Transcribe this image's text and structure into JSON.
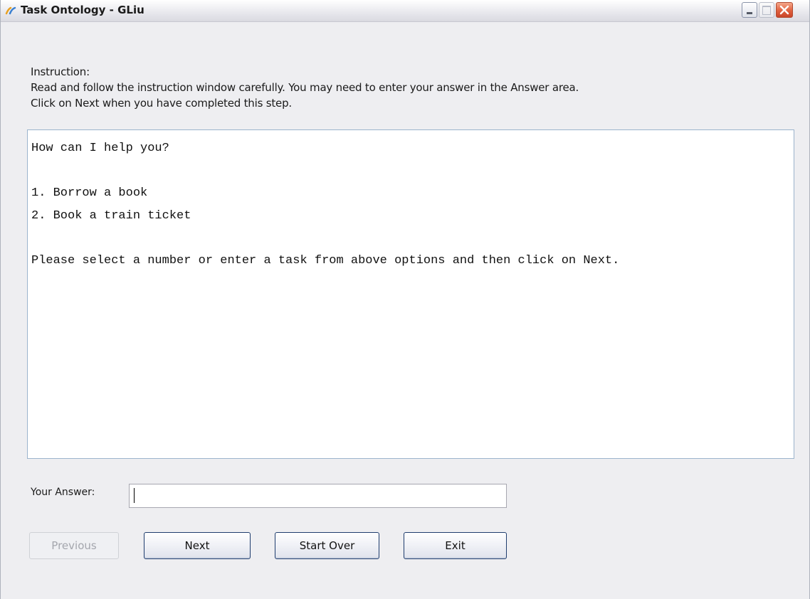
{
  "window": {
    "title": "Task Ontology - GLiu",
    "icon": "app-logo-icon",
    "controls": [
      "minimize-icon",
      "maximize-icon",
      "close-icon"
    ],
    "close_color": "#e0603e"
  },
  "instruction": {
    "line1": "Instruction:",
    "line2": "Read and follow the instruction window carefully. You may need to enter your answer in the Answer area.",
    "line3": "Click on Next when you have completed this step."
  },
  "dialog_text": "How can I help you?\n\n1. Borrow a book\n2. Book a train ticket\n\nPlease select a number or enter a task from above options and then click on Next.",
  "answer": {
    "label": "Your Answer:",
    "value": ""
  },
  "buttons": {
    "previous": "Previous",
    "next": "Next",
    "start_over": "Start Over",
    "exit": "Exit"
  }
}
